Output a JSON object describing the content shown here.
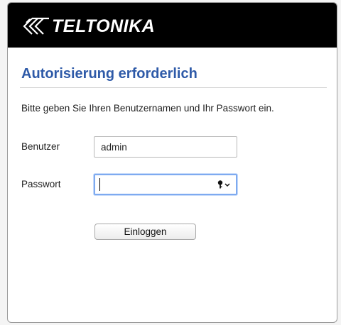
{
  "brand": {
    "logo_text": "TELTONIKA",
    "logo_icon": "teltonika-diamond-logo-icon"
  },
  "login": {
    "title": "Autorisierung erforderlich",
    "description": "Bitte geben Sie Ihren Benutzernamen und Ihr Passwort ein.",
    "username_label": "Benutzer",
    "username_value": "admin",
    "password_label": "Passwort",
    "password_value": "",
    "password_icon": "key-dropdown-icon",
    "submit_label": "Einloggen"
  },
  "colors": {
    "header_bg": "#000000",
    "title": "#2e5aa8",
    "focus_ring": "#7eaaf0"
  }
}
